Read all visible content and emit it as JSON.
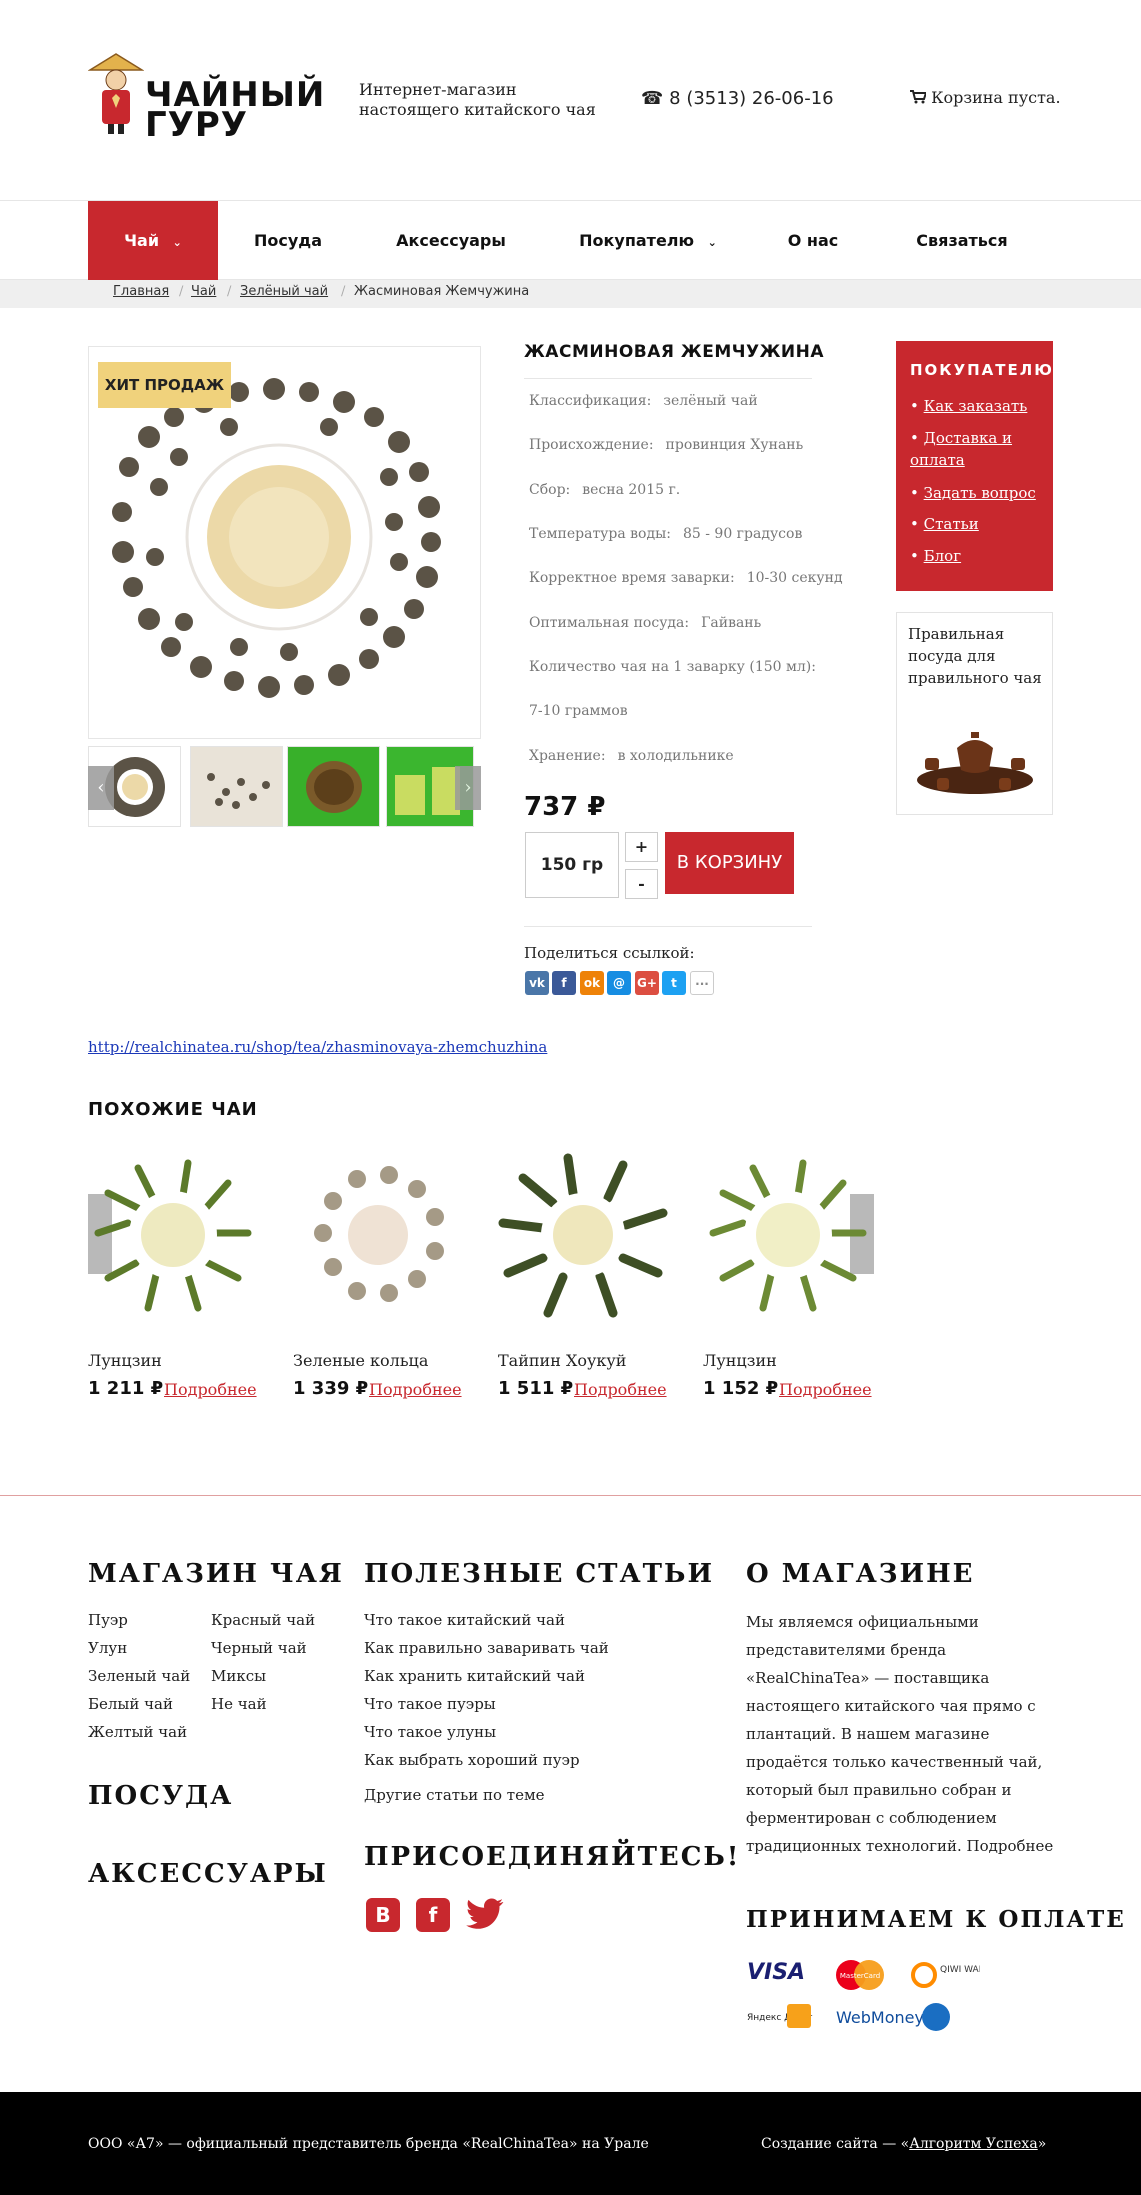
{
  "header": {
    "logo_text": "ЧАЙНЫЙ ГУРУ",
    "tagline_line1": "Интернет-магазин",
    "tagline_line2": "настоящего китайского чая",
    "phone": "8 (3513) 26-06-16",
    "cart": "Корзина пуста."
  },
  "nav": {
    "items": [
      {
        "label": "Чай",
        "dropdown": true,
        "active": true
      },
      {
        "label": "Посуда"
      },
      {
        "label": "Аксессуары"
      },
      {
        "label": "Покупателю",
        "dropdown": true
      },
      {
        "label": "О нас"
      },
      {
        "label": "Связаться"
      }
    ]
  },
  "breadcrumb": [
    "Главная",
    "Чай",
    "Зелёный чай",
    "Жасминовая Жемчужина"
  ],
  "product": {
    "badge": "ХИТ ПРОДАЖ",
    "title": "ЖАСМИНОВАЯ ЖЕМЧУЖИНА",
    "specs": [
      {
        "label": "Классификация:",
        "value": "зелёный чай"
      },
      {
        "label": "Происхождение:",
        "value": "провинция Хунань"
      },
      {
        "label": "Сбор:",
        "value": "весна 2015 г."
      },
      {
        "label": "Температура воды:",
        "value": "85 - 90 градусов"
      },
      {
        "label": "Корректное время заварки:",
        "value": "10-30 секунд"
      },
      {
        "label": "Оптимальная посуда:",
        "value": "Гайвань"
      },
      {
        "label": "Количество чая на 1 заварку (150 мл):",
        "value": ""
      },
      {
        "label": "7-10 граммов",
        "value": ""
      },
      {
        "label": "Хранение:",
        "value": "в холодильнике"
      }
    ],
    "price": "737 ₽",
    "quantity": "150 гр",
    "plus": "+",
    "minus": "-",
    "buy": "В КОРЗИНУ",
    "share_label": "Поделиться ссылкой:",
    "share_icons": [
      "vk-icon",
      "facebook-icon",
      "odnoklassniki-icon",
      "moimir-icon",
      "googleplus-icon",
      "twitter-icon",
      "more-icon"
    ],
    "url": "http://realchinatea.ru/shop/tea/zhasminovaya-zhemchuzhina"
  },
  "sidebar": {
    "heading": "ПОКУПАТЕЛЮ",
    "links": [
      "Как заказать",
      "Доставка и оплата",
      "Задать вопрос",
      "Статьи",
      "Блог"
    ],
    "promo": "Правильная посуда для правильного чая"
  },
  "similar": {
    "heading": "ПОХОЖИЕ ЧАИ",
    "more_label": "Подробнее",
    "items": [
      {
        "name": "Лунцзин",
        "price": "1 211 ₽"
      },
      {
        "name": "Зеленые кольца",
        "price": "1 339 ₽"
      },
      {
        "name": "Тайпин Хоукуй",
        "price": "1 511 ₽"
      },
      {
        "name": "Лунцзин",
        "price": "1 152 ₽"
      }
    ]
  },
  "footer": {
    "shop_heading": "МАГАЗИН ЧАЯ",
    "shop_col1": [
      "Пуэр",
      "Улун",
      "Зеленый чай",
      "Белый чай",
      "Желтый чай"
    ],
    "shop_col2": [
      "Красный чай",
      "Черный чай",
      "Миксы",
      "Не чай"
    ],
    "dishes_heading": "ПОСУДА",
    "accessories_heading": "АКСЕССУАРЫ",
    "articles_heading": "ПОЛЕЗНЫЕ СТАТЬИ",
    "articles": [
      "Что такое китайский чай",
      "Как правильно заваривать чай",
      "Как хранить китайский чай",
      "Что такое пуэры",
      "Что такое улуны",
      "Как выбрать хороший пуэр"
    ],
    "other_articles": "Другие статьи по теме",
    "join_heading": "ПРИСОЕДИНЯЙТЕСЬ!",
    "about_heading": "О МАГАЗИНЕ",
    "about_text": "Мы являемся официальными представителями бренда «RealChinaTea» — поставщика настоящего китайского чая прямо с плантаций. В нашем магазине продаётся только качественный чай, который был правильно собран и ферментирован с соблюдением традиционных технологий. Подробнее",
    "payment_heading": "ПРИНИМАЕМ К ОПЛАТЕ",
    "payments": {
      "visa": "VISA",
      "mastercard": "MasterCard",
      "qiwi": "QIWI WALLET",
      "yandex": "Яндекс Деньги",
      "webmoney": "WebMoney"
    },
    "copyright": "ООО «А7» — официальный представитель бренда «RealChinaTea» на Урале",
    "dev_prefix": "Создание сайта — «",
    "dev_link": "Алгоритм Успеха",
    "dev_suffix": "»"
  },
  "colors": {
    "accent": "#c8282e",
    "badge": "#f0d27c",
    "footer_bg": "#000000"
  }
}
